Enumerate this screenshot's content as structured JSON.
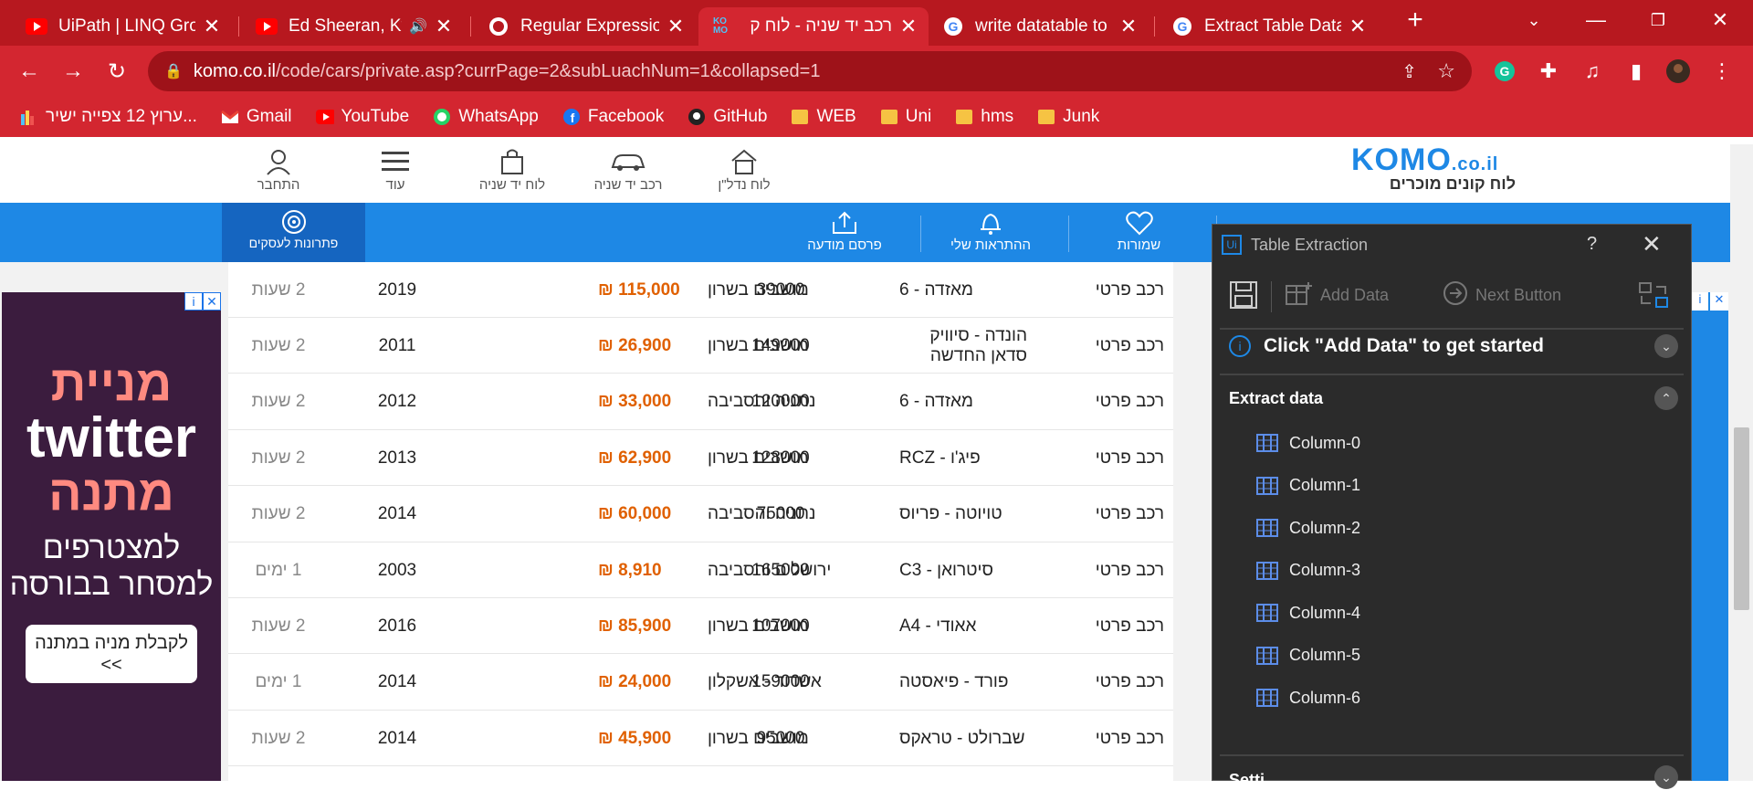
{
  "browser": {
    "tabs": [
      {
        "title": "UiPath | LINQ Group",
        "icon": "youtube-icon",
        "active": false
      },
      {
        "title": "Ed Sheeran, Kyg",
        "icon": "youtube-icon",
        "active": false,
        "audio": true
      },
      {
        "title": "Regular Expressions",
        "icon": "globe-icon",
        "active": false
      },
      {
        "title": "רכב יד שניה - לוח ק",
        "icon": "komo-icon",
        "active": true
      },
      {
        "title": "write datatable to e",
        "icon": "google-icon",
        "active": false
      },
      {
        "title": "Extract Table Data v",
        "icon": "google-icon",
        "active": false
      }
    ],
    "url_host": "komo.co.il",
    "url_rest": "/code/cars/private.asp?currPage=2&subLuachNum=1&collapsed=1",
    "bookmarks": [
      {
        "label": "ערוץ 12 צפייה ישיר...",
        "icon": "n12-icon"
      },
      {
        "label": "Gmail",
        "icon": "gmail-icon"
      },
      {
        "label": "YouTube",
        "icon": "youtube-icon"
      },
      {
        "label": "WhatsApp",
        "icon": "whatsapp-icon"
      },
      {
        "label": "Facebook",
        "icon": "facebook-icon"
      },
      {
        "label": "GitHub",
        "icon": "github-icon"
      },
      {
        "label": "WEB",
        "icon": "folder-icon"
      },
      {
        "label": "Uni",
        "icon": "folder-icon"
      },
      {
        "label": "hms",
        "icon": "folder-icon"
      },
      {
        "label": "Junk",
        "icon": "folder-icon"
      }
    ]
  },
  "site": {
    "logo_main": "KOMO",
    "logo_tld": ".co.il",
    "logo_tagline": "לוח קונים מוכרים",
    "nav": [
      {
        "label": "התחבר",
        "icon": "user-icon"
      },
      {
        "label": "עוד",
        "icon": "menu-icon"
      },
      {
        "label": "לוח יד שניה",
        "icon": "bag-icon"
      },
      {
        "label": "רכב יד שניה",
        "icon": "car-icon"
      },
      {
        "label": "לוח נדל\"ן",
        "icon": "house-icon"
      }
    ],
    "bluebar": {
      "business": "פתרונות לעסקים",
      "publish": "פרסם מודעה",
      "alerts": "ההתראות שלי",
      "saved": "שמורות"
    }
  },
  "ad": {
    "line1": "מניית",
    "line2": "twitter",
    "line3": "מתנה",
    "line4": "למצטרפים למסחר בבורסה",
    "button": "לקבלת מניה במתנה <<"
  },
  "listing": {
    "rows": [
      {
        "type": "רכב פרטי",
        "model": "מאזדה - 6",
        "location": "מושבים בשרון",
        "km": "39000",
        "price": "115,000 ₪",
        "year": "2019",
        "age": "2 שעות"
      },
      {
        "type": "רכב פרטי",
        "model": "הונדה - סיוויק סדאן החדשה",
        "location": "מושבים בשרון",
        "km": "149000",
        "price": "26,900 ₪",
        "year": "2011",
        "age": "2 שעות"
      },
      {
        "type": "רכב פרטי",
        "model": "מאזדה - 6",
        "location": "נתניה והסביבה",
        "km": "120000",
        "price": "33,000 ₪",
        "year": "2012",
        "age": "2 שעות"
      },
      {
        "type": "רכב פרטי",
        "model": "פיג'ו - RCZ",
        "location": "מושבים בשרון",
        "km": "128000",
        "price": "62,900 ₪",
        "year": "2013",
        "age": "2 שעות"
      },
      {
        "type": "רכב פרטי",
        "model": "טויוטה - פריוס",
        "location": "נתניה והסביבה",
        "km": "75000",
        "price": "60,000 ₪",
        "year": "2014",
        "age": "2 שעות"
      },
      {
        "type": "רכב פרטי",
        "model": "סיטרואן - C3",
        "location": "ירושלים והסביבה",
        "km": "165000",
        "price": "8,910 ₪",
        "year": "2003",
        "age": "1 ימים"
      },
      {
        "type": "רכב פרטי",
        "model": "אאודי - A4",
        "location": "מושבים בשרון",
        "km": "107000",
        "price": "85,900 ₪",
        "year": "2016",
        "age": "2 שעות"
      },
      {
        "type": "רכב פרטי",
        "model": "פורד - פיאסטה",
        "location": "אשדוד - אשקלון",
        "km": "159000",
        "price": "24,000 ₪",
        "year": "2014",
        "age": "1 ימים"
      },
      {
        "type": "רכב פרטי",
        "model": "שברולט - טראקס",
        "location": "מושבים בשרון",
        "km": "95000",
        "price": "45,900 ₪",
        "year": "2014",
        "age": "2 שעות"
      }
    ]
  },
  "extraction": {
    "title": "Table Extraction",
    "add_data": "Add Data",
    "next_button": "Next Button",
    "get_started": "Click \"Add Data\" to get started",
    "extract_title": "Extract data",
    "columns": [
      "Column-0",
      "Column-1",
      "Column-2",
      "Column-3",
      "Column-4",
      "Column-5",
      "Column-6"
    ],
    "settings": "Setti"
  },
  "colors": {
    "chrome": "#d32630",
    "accent": "#1e88e5",
    "price": "#e06000"
  }
}
